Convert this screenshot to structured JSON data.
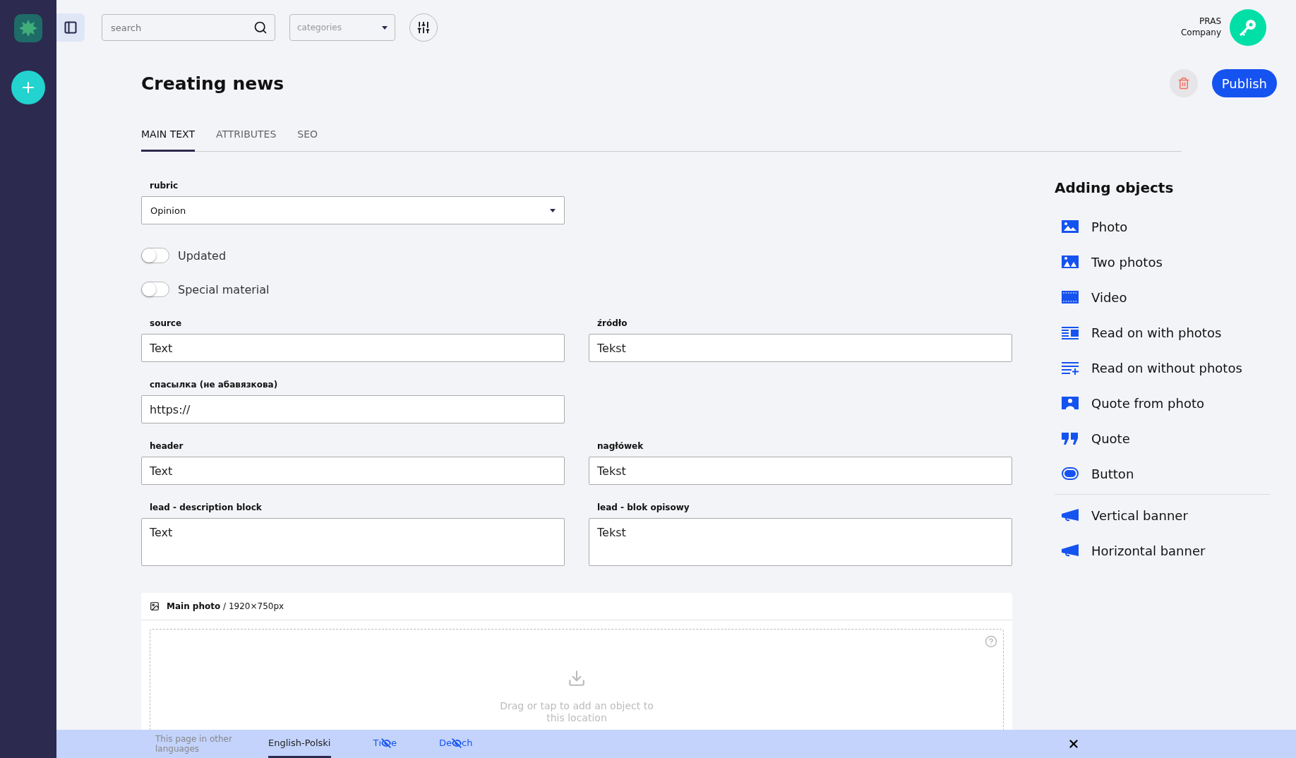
{
  "topbar": {
    "search": {
      "placeholder": "search"
    },
    "categories": {
      "placeholder": "categories"
    },
    "account": {
      "name": "PRAS",
      "sub": "Company"
    }
  },
  "page": {
    "title": "Creating news",
    "publish": "Publish"
  },
  "tabs": [
    {
      "label": "MAIN TEXT",
      "selected": true
    },
    {
      "label": "ATTRIBUTES",
      "selected": false
    },
    {
      "label": "SEO",
      "selected": false
    }
  ],
  "rubric": {
    "label": "rubric",
    "value": "Opinion"
  },
  "toggles": [
    {
      "label": "Updated",
      "on": false
    },
    {
      "label": "Special material",
      "on": false
    }
  ],
  "field_rows": [
    {
      "fields": [
        {
          "label": "source",
          "value": "Text",
          "kind": "input"
        },
        {
          "label": "źródło",
          "value": "Tekst",
          "kind": "input"
        }
      ]
    },
    {
      "fields": [
        {
          "label": "спасылка (не абавязкова)",
          "value": "https://",
          "kind": "input"
        }
      ]
    },
    {
      "fields": [
        {
          "label": "header",
          "value": "Text",
          "kind": "input"
        },
        {
          "label": "nagłówek",
          "value": "Tekst",
          "kind": "input"
        }
      ]
    },
    {
      "fields": [
        {
          "label": "lead - description block",
          "value": "Text",
          "kind": "textarea"
        },
        {
          "label": "lead - blok opisowy",
          "value": "Tekst",
          "kind": "textarea"
        }
      ]
    }
  ],
  "main_photo": {
    "title": "Main photo",
    "size": "/ 1920×750px",
    "hint": "Drag or tap to add an object to this location"
  },
  "objects": {
    "title": "Adding objects",
    "items": [
      {
        "label": "Photo",
        "kind": "photo"
      },
      {
        "label": "Two photos",
        "kind": "two-photos"
      },
      {
        "label": "Video",
        "kind": "video"
      },
      {
        "label": "Read on with photos",
        "kind": "read-photos"
      },
      {
        "label": "Read on without photos",
        "kind": "read-text"
      },
      {
        "label": "Quote from photo",
        "kind": "person"
      },
      {
        "label": "Quote",
        "kind": "quote"
      },
      {
        "label": "Button",
        "kind": "button"
      },
      {
        "label": "Vertical banner",
        "kind": "banner"
      },
      {
        "label": "Horizontal banner",
        "kind": "banner"
      }
    ]
  },
  "language_bar": {
    "note": "This page in other languages",
    "langs": [
      {
        "before": "English-Polski",
        "selected": true
      },
      {
        "before": "Tı",
        "after": "e",
        "selected": false
      },
      {
        "before": "De",
        "after": "ch",
        "selected": false
      }
    ]
  }
}
